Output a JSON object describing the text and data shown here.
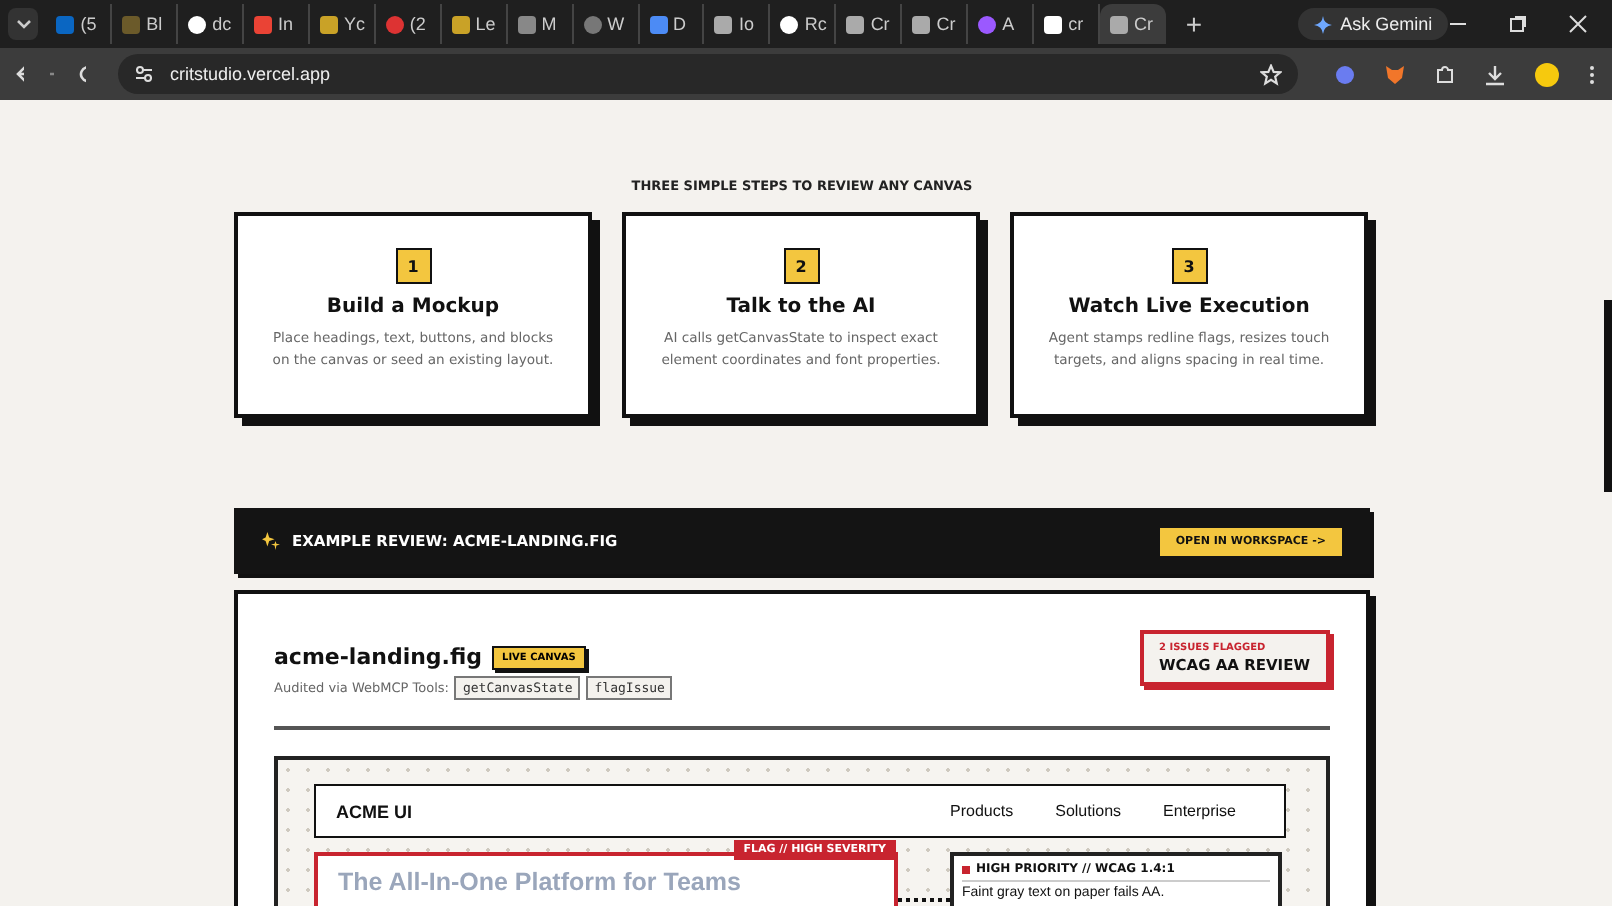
{
  "browser": {
    "tabs": [
      {
        "label": "(5",
        "selected": false
      },
      {
        "label": "Bl",
        "selected": false
      },
      {
        "label": "dc",
        "selected": false
      },
      {
        "label": "In",
        "selected": false
      },
      {
        "label": "Yc",
        "selected": false
      },
      {
        "label": "(2",
        "selected": false
      },
      {
        "label": "Le",
        "selected": false
      },
      {
        "label": "M",
        "selected": false
      },
      {
        "label": "W",
        "selected": false
      },
      {
        "label": "D",
        "selected": false
      },
      {
        "label": "Io",
        "selected": false
      },
      {
        "label": "Rc",
        "selected": false
      },
      {
        "label": "Cr",
        "selected": false
      },
      {
        "label": "Cr",
        "selected": false
      },
      {
        "label": "A",
        "selected": false
      },
      {
        "label": "cr",
        "selected": false
      },
      {
        "label": "Cr",
        "selected": true
      }
    ],
    "new_tab": "+",
    "ask_gemini": "Ask Gemini",
    "url": "critstudio.vercel.app"
  },
  "steps": {
    "heading": "THREE SIMPLE STEPS TO REVIEW ANY CANVAS",
    "items": [
      {
        "number": "1",
        "title": "Build a Mockup",
        "text": "Place headings, text, buttons, and blocks on the canvas or seed an existing layout."
      },
      {
        "number": "2",
        "title": "Talk to the AI",
        "text": "AI calls getCanvasState to inspect exact element coordinates and font properties."
      },
      {
        "number": "3",
        "title": "Watch Live Execution",
        "text": "Agent stamps redline flags, resizes touch targets, and aligns spacing in real time."
      }
    ]
  },
  "example": {
    "title": "EXAMPLE REVIEW: ACME-LANDING.FIG",
    "button": "OPEN IN WORKSPACE ->"
  },
  "review": {
    "file": "acme-landing.fig",
    "badge": "LIVE CANVAS",
    "audited_label": "Audited via WebMCP Tools:",
    "tools": [
      "getCanvasState",
      "flagIssue"
    ],
    "issues_count": "2 ISSUES FLAGGED",
    "review_type": "WCAG AA REVIEW"
  },
  "mockup": {
    "logo": "ACME UI",
    "nav": [
      "Products",
      "Solutions",
      "Enterprise"
    ],
    "hero_title": "The All-In-One Platform for Teams",
    "flag": "FLAG // HIGH SEVERITY",
    "note": {
      "title": "HIGH PRIORITY // WCAG 1.4:1",
      "text": "Faint gray text on paper fails AA."
    }
  }
}
